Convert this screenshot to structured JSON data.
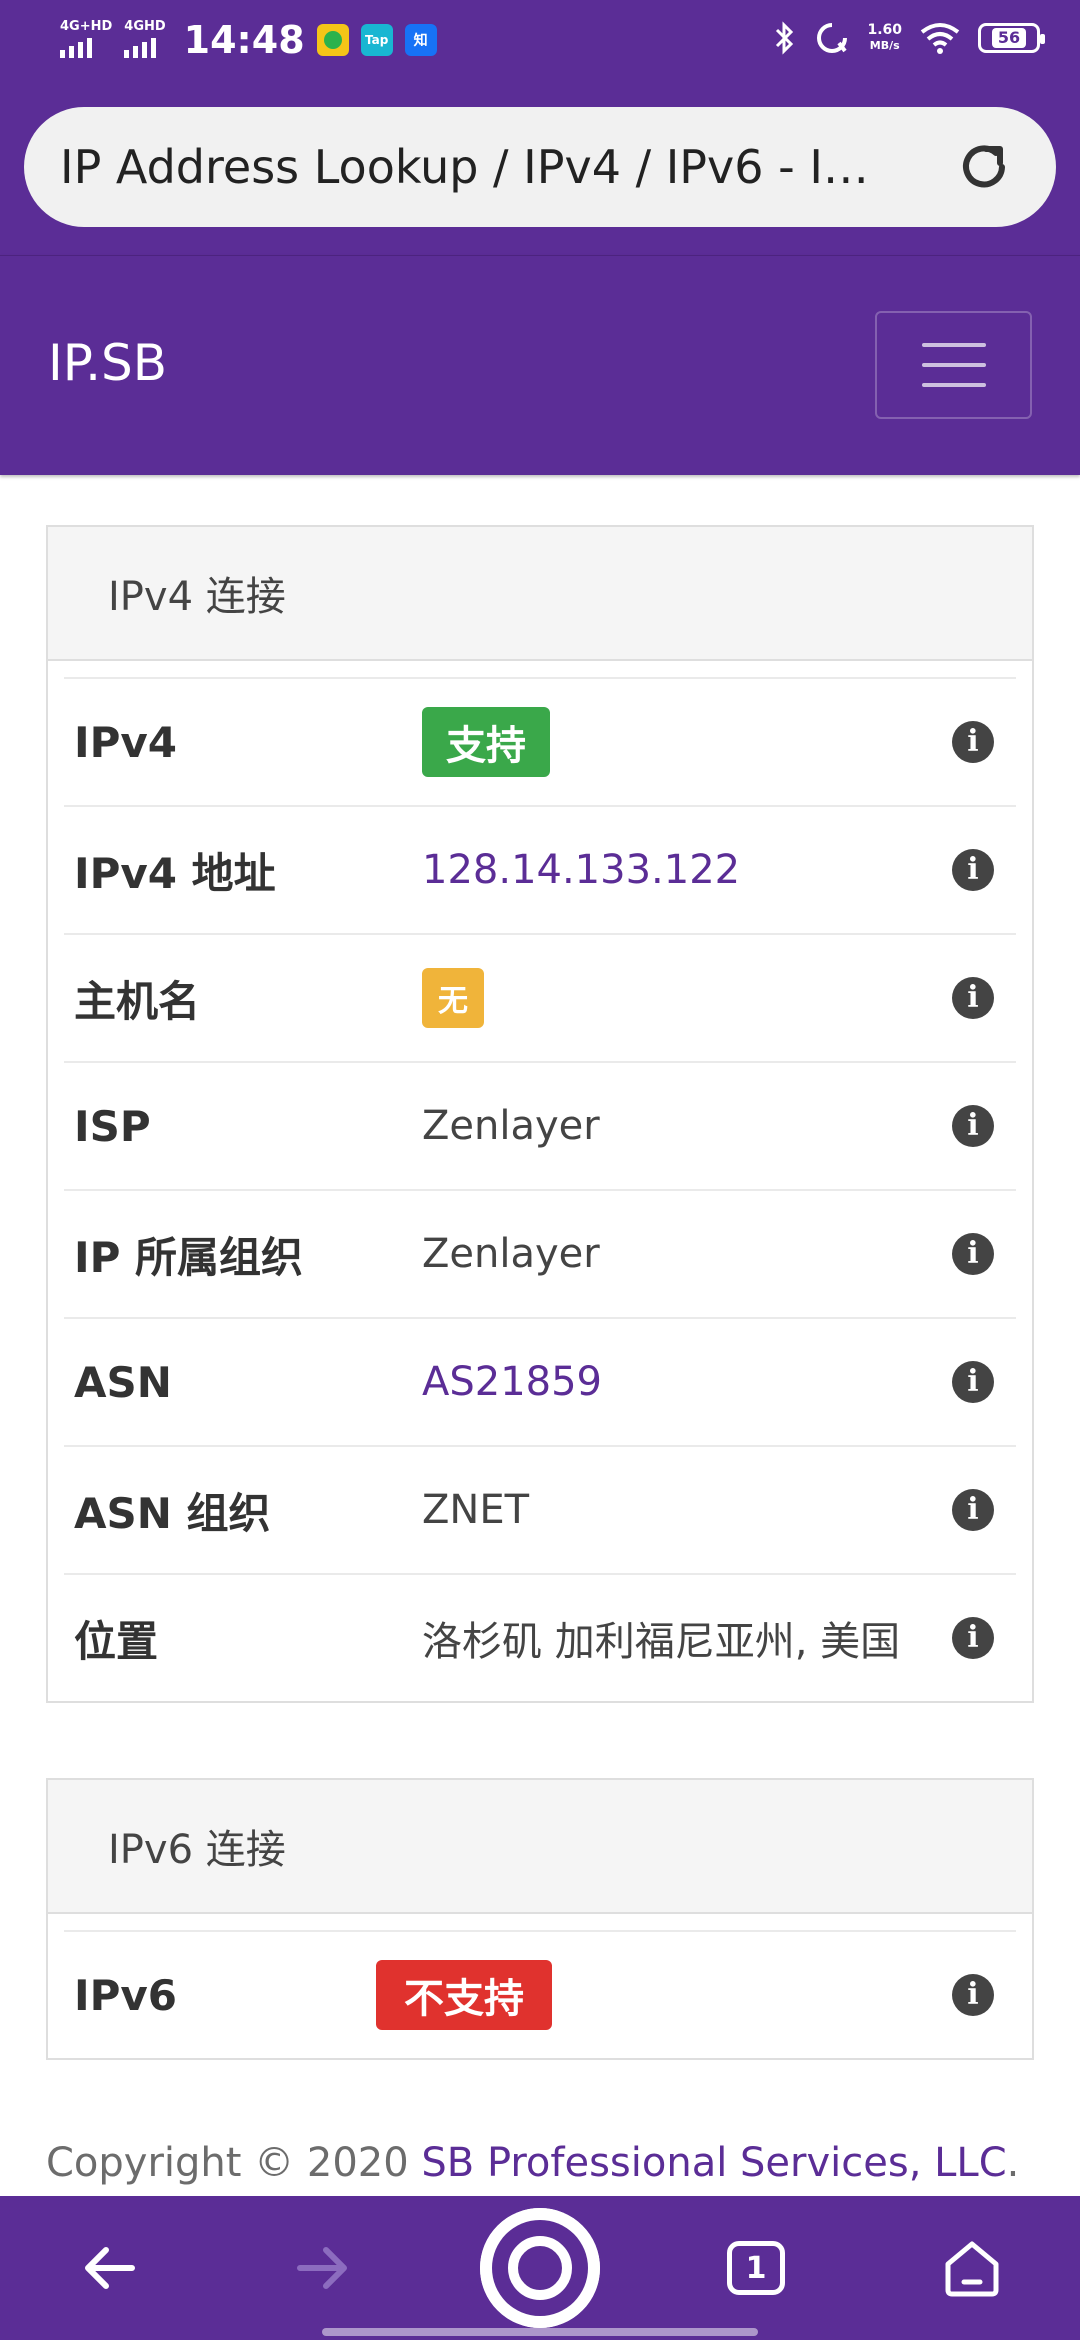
{
  "status_bar": {
    "network_1": "4G+HD",
    "network_2": "4GHD",
    "time": "14:48",
    "app_badges": [
      {
        "name": "green-circle-app-icon",
        "text": "",
        "bg": "#f5c518"
      },
      {
        "name": "tap-app-icon",
        "text": "Tap",
        "bg": "#19b6d2"
      },
      {
        "name": "zhihu-app-icon",
        "text": "知",
        "bg": "#1772f6"
      }
    ],
    "speed_value": "1.60",
    "speed_unit": "MB/s",
    "battery": "56"
  },
  "browser": {
    "url_title": "IP Address Lookup / IPv4 / IPv6 - I…"
  },
  "navbar": {
    "brand": "IP.SB"
  },
  "ipv4_card": {
    "header": "IPv4 连接",
    "rows": [
      {
        "label": "IPv4",
        "value": "支持",
        "kind": "badge-green"
      },
      {
        "label": "IPv4 地址",
        "value": "128.14.133.122",
        "kind": "link"
      },
      {
        "label": "主机名",
        "value": "无",
        "kind": "badge-yellow"
      },
      {
        "label": "ISP",
        "value": "Zenlayer",
        "kind": "text"
      },
      {
        "label": "IP 所属组织",
        "value": "Zenlayer",
        "kind": "text"
      },
      {
        "label": "ASN",
        "value": "AS21859",
        "kind": "link"
      },
      {
        "label": "ASN 组织",
        "value": "ZNET",
        "kind": "text"
      },
      {
        "label": "位置",
        "value": "洛杉矶 加利福尼亚州, 美国",
        "kind": "text"
      }
    ]
  },
  "ipv6_card": {
    "header": "IPv6 连接",
    "rows": [
      {
        "label": "IPv6",
        "value": "不支持",
        "kind": "badge-red"
      }
    ]
  },
  "footer": {
    "copyright_prefix": "Copyright © 2020 ",
    "company": "SB Professional Services, LLC",
    "suffix": "."
  },
  "bottom_nav": {
    "tab_count": "1"
  },
  "colors": {
    "brand_purple": "#5b2d96",
    "success_green": "#3aa84a",
    "warning_yellow": "#f0b43a",
    "danger_red": "#e0322e"
  }
}
